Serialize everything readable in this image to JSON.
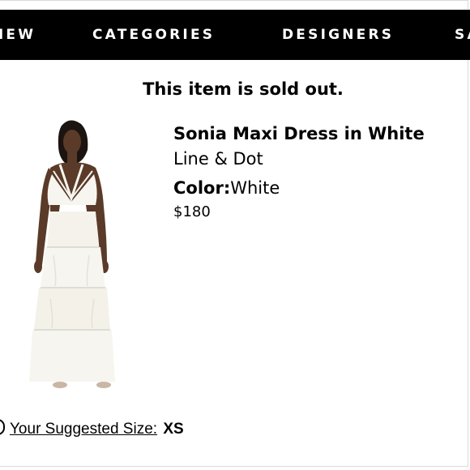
{
  "nav": {
    "items": [
      {
        "label": "NEW"
      },
      {
        "label": "CATEGORIES"
      },
      {
        "label": "DESIGNERS"
      },
      {
        "label": "SALE"
      }
    ]
  },
  "status": {
    "sold_out_message": "This item is sold out."
  },
  "product": {
    "name": "Sonia Maxi Dress in White",
    "brand": "Line & Dot",
    "color_label": "Color:",
    "color_value": "White",
    "price": "$180"
  },
  "size_suggestion": {
    "link_label": "Your Suggested Size:",
    "value": "XS"
  }
}
